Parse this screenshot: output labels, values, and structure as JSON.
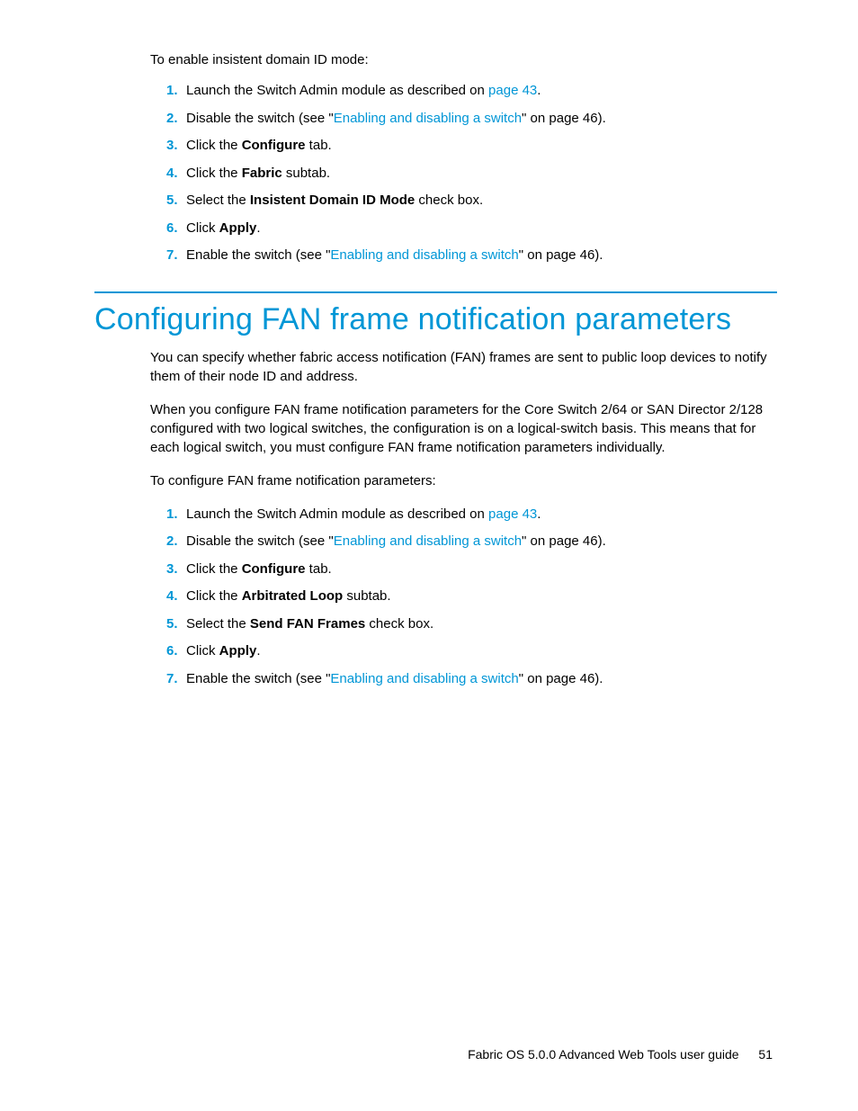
{
  "section1": {
    "intro": "To enable insistent domain ID mode:",
    "steps": [
      {
        "num": "1.",
        "pre": "Launch the Switch Admin module as described on ",
        "link": "page 43",
        "post": "."
      },
      {
        "num": "2.",
        "pre": "Disable the switch (see \"",
        "link": "Enabling and disabling a switch",
        "post": "\" on page 46)."
      },
      {
        "num": "3.",
        "pre": "Click the ",
        "bold": "Configure",
        "post": " tab."
      },
      {
        "num": "4.",
        "pre": "Click the ",
        "bold": "Fabric",
        "post": " subtab."
      },
      {
        "num": "5.",
        "pre": "Select the ",
        "bold": "Insistent Domain ID Mode",
        "post": " check box."
      },
      {
        "num": "6.",
        "pre": "Click ",
        "bold": "Apply",
        "post": "."
      },
      {
        "num": "7.",
        "pre": "Enable the switch (see \"",
        "link": "Enabling and disabling a switch",
        "post": "\" on page 46)."
      }
    ]
  },
  "section2": {
    "heading": "Configuring FAN frame notification parameters",
    "para1": "You can specify whether fabric access notification (FAN) frames are sent to public loop devices to notify them of their node ID and address.",
    "para2": "When you configure FAN frame notification parameters for the Core Switch 2/64 or SAN Director 2/128 configured with two logical switches, the configuration is on a logical-switch basis. This means that for each logical switch, you must configure FAN frame notification parameters individually.",
    "intro": "To configure FAN frame notification parameters:",
    "steps": [
      {
        "num": "1.",
        "pre": "Launch the Switch Admin module as described on ",
        "link": "page 43",
        "post": "."
      },
      {
        "num": "2.",
        "pre": "Disable the switch (see \"",
        "link": "Enabling and disabling a switch",
        "post": "\" on page 46)."
      },
      {
        "num": "3.",
        "pre": "Click the ",
        "bold": "Configure",
        "post": " tab."
      },
      {
        "num": "4.",
        "pre": "Click the ",
        "bold": "Arbitrated Loop",
        "post": " subtab."
      },
      {
        "num": "5.",
        "pre": "Select the ",
        "bold": "Send FAN Frames",
        "post": " check box."
      },
      {
        "num": "6.",
        "pre": "Click ",
        "bold": "Apply",
        "post": "."
      },
      {
        "num": "7.",
        "pre": "Enable the switch (see \"",
        "link": "Enabling and disabling a switch",
        "post": "\" on page 46)."
      }
    ]
  },
  "footer": {
    "title": "Fabric OS 5.0.0 Advanced Web Tools user guide",
    "page": "51"
  }
}
